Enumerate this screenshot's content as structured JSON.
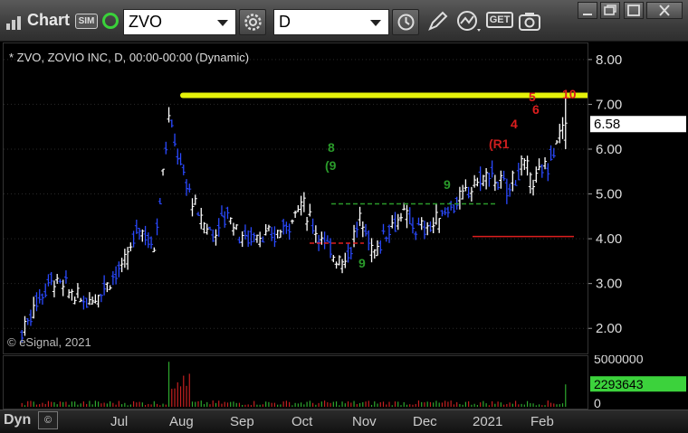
{
  "toolbar": {
    "app_title": "Chart",
    "sim_badge": "SIM",
    "symbol_value": "ZVO",
    "interval_value": "D",
    "get_label": "GET",
    "icons": [
      "app-icon",
      "link-icon",
      "settings-icon",
      "clock-icon",
      "pencil-icon",
      "indicator-icon",
      "get-icon",
      "screenshot-icon",
      "minimize-icon",
      "restore-icon",
      "maximize-icon",
      "close-icon"
    ]
  },
  "chart": {
    "subtitle": "* ZVO, ZOVIO INC, D, 00:00-00:00 (Dynamic)",
    "copyright": "© eSignal, 2021",
    "last_price": "6.58",
    "last_volume": "2293643",
    "price_ticks": [
      "8.00",
      "7.00",
      "6.00",
      "5.00",
      "4.00",
      "3.00",
      "2.00"
    ],
    "volume_ticks": [
      "5000000",
      "0"
    ],
    "time_labels": [
      "Jul",
      "Aug",
      "Sep",
      "Oct",
      "Nov",
      "Dec",
      "2021",
      "Feb"
    ],
    "dyn_label": "Dyn",
    "dyn_button": "©",
    "colors": {
      "background": "#000000",
      "up_bar": "#ffffff",
      "down_bar": "#2a49ff",
      "resistance": "#e5f20a",
      "support_green": "#2a9a2a",
      "support_red": "#dd1e1e",
      "last_price_badge": "#ffffff",
      "volume_badge": "#3cd23c"
    }
  },
  "chart_data": {
    "type": "ohlc",
    "title": "* ZVO, ZOVIO INC, D, 00:00-00:00 (Dynamic)",
    "ylim": [
      1.5,
      8.3
    ],
    "y_ticks": [
      2,
      3,
      4,
      5,
      6,
      7,
      8
    ],
    "x_labels": [
      "Jul",
      "Aug",
      "Sep",
      "Oct",
      "Nov",
      "Dec",
      "2021",
      "Feb"
    ],
    "close_series": [
      {
        "date": "2020-06-01",
        "close": 1.9
      },
      {
        "date": "2020-06-08",
        "close": 2.6
      },
      {
        "date": "2020-06-15",
        "close": 3.1
      },
      {
        "date": "2020-06-22",
        "close": 2.9
      },
      {
        "date": "2020-06-29",
        "close": 2.6
      },
      {
        "date": "2020-07-06",
        "close": 2.7
      },
      {
        "date": "2020-07-13",
        "close": 3.1
      },
      {
        "date": "2020-07-20",
        "close": 3.4
      },
      {
        "date": "2020-07-27",
        "close": 4.3
      },
      {
        "date": "2020-08-03",
        "close": 3.8
      },
      {
        "date": "2020-08-10",
        "close": 6.7
      },
      {
        "date": "2020-08-17",
        "close": 5.4
      },
      {
        "date": "2020-08-24",
        "close": 4.5
      },
      {
        "date": "2020-08-31",
        "close": 4.1
      },
      {
        "date": "2020-09-07",
        "close": 4.6
      },
      {
        "date": "2020-09-14",
        "close": 4.0
      },
      {
        "date": "2020-09-21",
        "close": 4.1
      },
      {
        "date": "2020-09-28",
        "close": 4.0
      },
      {
        "date": "2020-10-05",
        "close": 4.3
      },
      {
        "date": "2020-10-12",
        "close": 4.8
      },
      {
        "date": "2020-10-19",
        "close": 4.2
      },
      {
        "date": "2020-10-26",
        "close": 3.7
      },
      {
        "date": "2020-11-02",
        "close": 3.5
      },
      {
        "date": "2020-11-09",
        "close": 4.4
      },
      {
        "date": "2020-11-16",
        "close": 3.7
      },
      {
        "date": "2020-11-23",
        "close": 4.3
      },
      {
        "date": "2020-11-30",
        "close": 4.5
      },
      {
        "date": "2020-12-07",
        "close": 4.2
      },
      {
        "date": "2020-12-14",
        "close": 4.3
      },
      {
        "date": "2020-12-21",
        "close": 4.7
      },
      {
        "date": "2020-12-28",
        "close": 4.9
      },
      {
        "date": "2021-01-04",
        "close": 5.3
      },
      {
        "date": "2021-01-11",
        "close": 5.4
      },
      {
        "date": "2021-01-18",
        "close": 5.1
      },
      {
        "date": "2021-01-25",
        "close": 5.6
      },
      {
        "date": "2021-02-01",
        "close": 5.3
      },
      {
        "date": "2021-02-08",
        "close": 5.8
      },
      {
        "date": "2021-02-15",
        "close": 6.58
      }
    ],
    "volume_ylim": [
      0,
      5000000
    ],
    "last_volume": 2293643,
    "lines": [
      {
        "name": "resistance",
        "y": 7.2,
        "color": "#e5f20a"
      },
      {
        "name": "green-level",
        "y": 4.78,
        "color": "#2a9a2a"
      },
      {
        "name": "red-level-oct",
        "y": 3.9,
        "color": "#dd1e1e"
      },
      {
        "name": "red-level-jan",
        "y": 4.05,
        "color": "#dd1e1e"
      }
    ],
    "annotations": [
      {
        "text": "8",
        "color": "#2a9a2a"
      },
      {
        "text": "(9",
        "color": "#2a9a2a"
      },
      {
        "text": "9",
        "color": "#2a9a2a"
      },
      {
        "text": "9",
        "color": "#2a9a2a"
      },
      {
        "text": "(R1",
        "color": "#cc1e1e"
      },
      {
        "text": "4",
        "color": "#dd1e1e"
      },
      {
        "text": "5",
        "color": "#dd1e1e"
      },
      {
        "text": "6",
        "color": "#dd1e1e"
      },
      {
        "text": "10",
        "color": "#dd1e1e"
      }
    ]
  }
}
